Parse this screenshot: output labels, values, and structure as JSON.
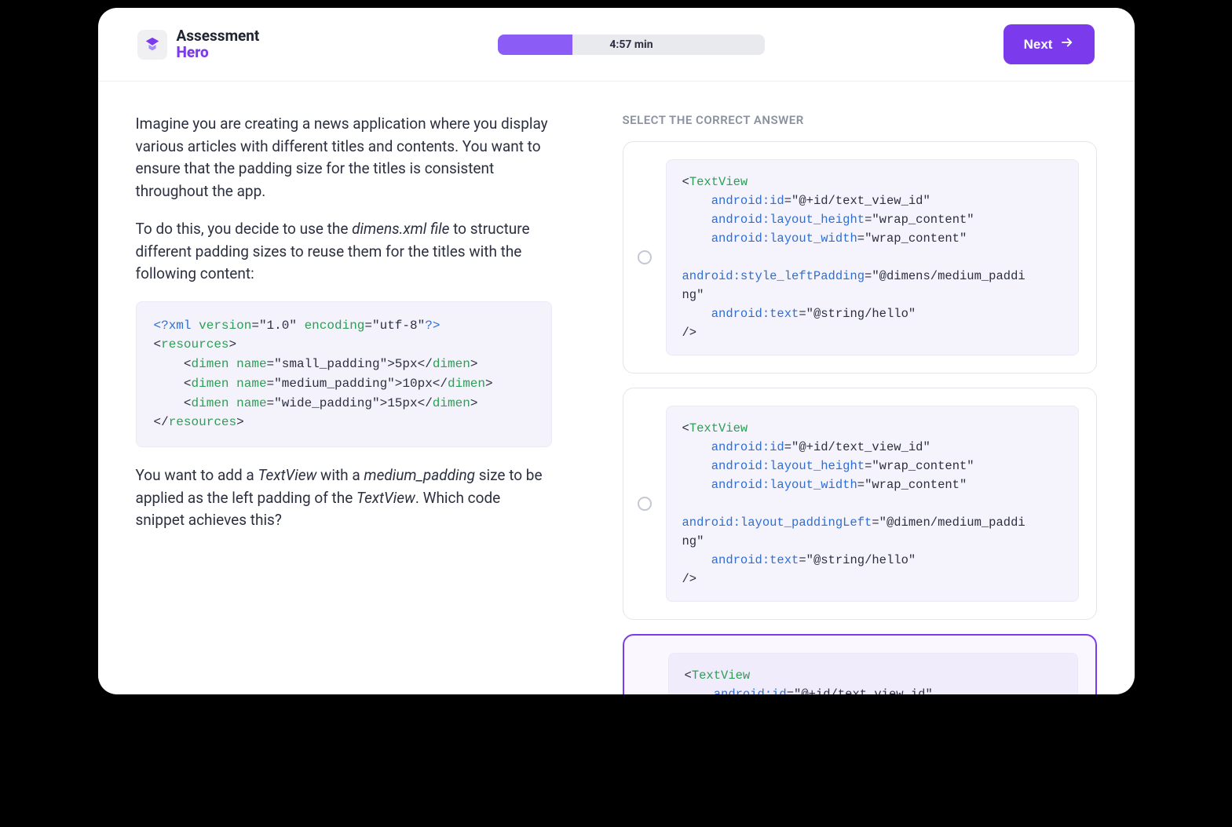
{
  "header": {
    "logo_line1": "Assessment",
    "logo_line2": "Hero",
    "timer": "4:57 min",
    "next_label": "Next"
  },
  "question": {
    "para1": "Imagine you are creating a news application where you display various articles with different titles and contents. You want to ensure that the padding size for the titles is consistent throughout the app.",
    "para2_a": "To do this, you decide to use the ",
    "para2_em": "dimens.xml file",
    "para2_b": " to structure different padding sizes to reuse them for the titles with the following content:",
    "para3_a": "You want to add a ",
    "para3_em1": "TextView",
    "para3_b": " with a ",
    "para3_em2": "medium_padding",
    "para3_c": " size to be applied as the left padding of the ",
    "para3_em3": "TextView",
    "para3_d": ". Which code snippet achieves this?",
    "xml": {
      "decl_open": "<?xml",
      "version_attr": "version",
      "version_val": "\"1.0\"",
      "encoding_attr": "encoding",
      "encoding_val": "\"utf-8\"",
      "decl_close": "?>",
      "resources": "resources",
      "dimen": "dimen",
      "name_attr": "name",
      "small_name": "\"small_padding\"",
      "small_val": "5px",
      "medium_name": "\"medium_padding\"",
      "medium_val": "10px",
      "wide_name": "\"wide_padding\"",
      "wide_val": "15px"
    }
  },
  "answers": {
    "label": "SELECT THE CORRECT ANSWER",
    "tag": "TextView",
    "attrs": {
      "id": "android:id",
      "id_val": "\"@+id/text_view_id\"",
      "h": "android:layout_height",
      "h_val": "\"wrap_content\"",
      "w": "android:layout_width",
      "w_val": "\"wrap_content\"",
      "text": "android:text",
      "text_val": "\"@string/hello\""
    },
    "opt1": {
      "key": "android:style_leftPadding",
      "val": "\"@dimens/medium_paddi\nng\""
    },
    "opt2": {
      "key": "android:layout_paddingLeft",
      "val": "\"@dimen/medium_paddi\nng\""
    },
    "opt3_selected": true
  }
}
